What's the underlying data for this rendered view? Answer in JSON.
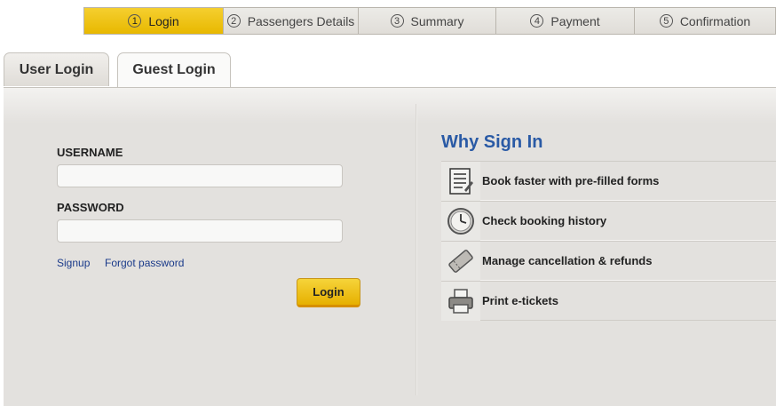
{
  "stepper": {
    "steps": [
      {
        "num": "1",
        "label": "Login"
      },
      {
        "num": "2",
        "label": "Passengers Details"
      },
      {
        "num": "3",
        "label": "Summary"
      },
      {
        "num": "4",
        "label": "Payment"
      },
      {
        "num": "5",
        "label": "Confirmation"
      }
    ],
    "active_index": 0
  },
  "tabs": [
    {
      "label": "User Login"
    },
    {
      "label": "Guest Login"
    }
  ],
  "active_tab": "Guest Login",
  "form": {
    "username_label": "USERNAME",
    "username_value": "",
    "password_label": "PASSWORD",
    "password_value": "",
    "signup_link": "Signup",
    "forgot_link": "Forgot password",
    "login_button": "Login"
  },
  "why_sign_in": {
    "title": "Why Sign In",
    "items": [
      {
        "icon": "form-icon",
        "label": "Book faster with pre-filled forms"
      },
      {
        "icon": "clock-icon",
        "label": "Check booking history"
      },
      {
        "icon": "ticket-icon",
        "label": "Manage cancellation & refunds"
      },
      {
        "icon": "printer-icon",
        "label": "Print e-tickets"
      }
    ]
  },
  "colors": {
    "accent_yellow": "#f0c20f",
    "title_blue": "#2a5aa5",
    "link_blue": "#1a3a8a"
  }
}
